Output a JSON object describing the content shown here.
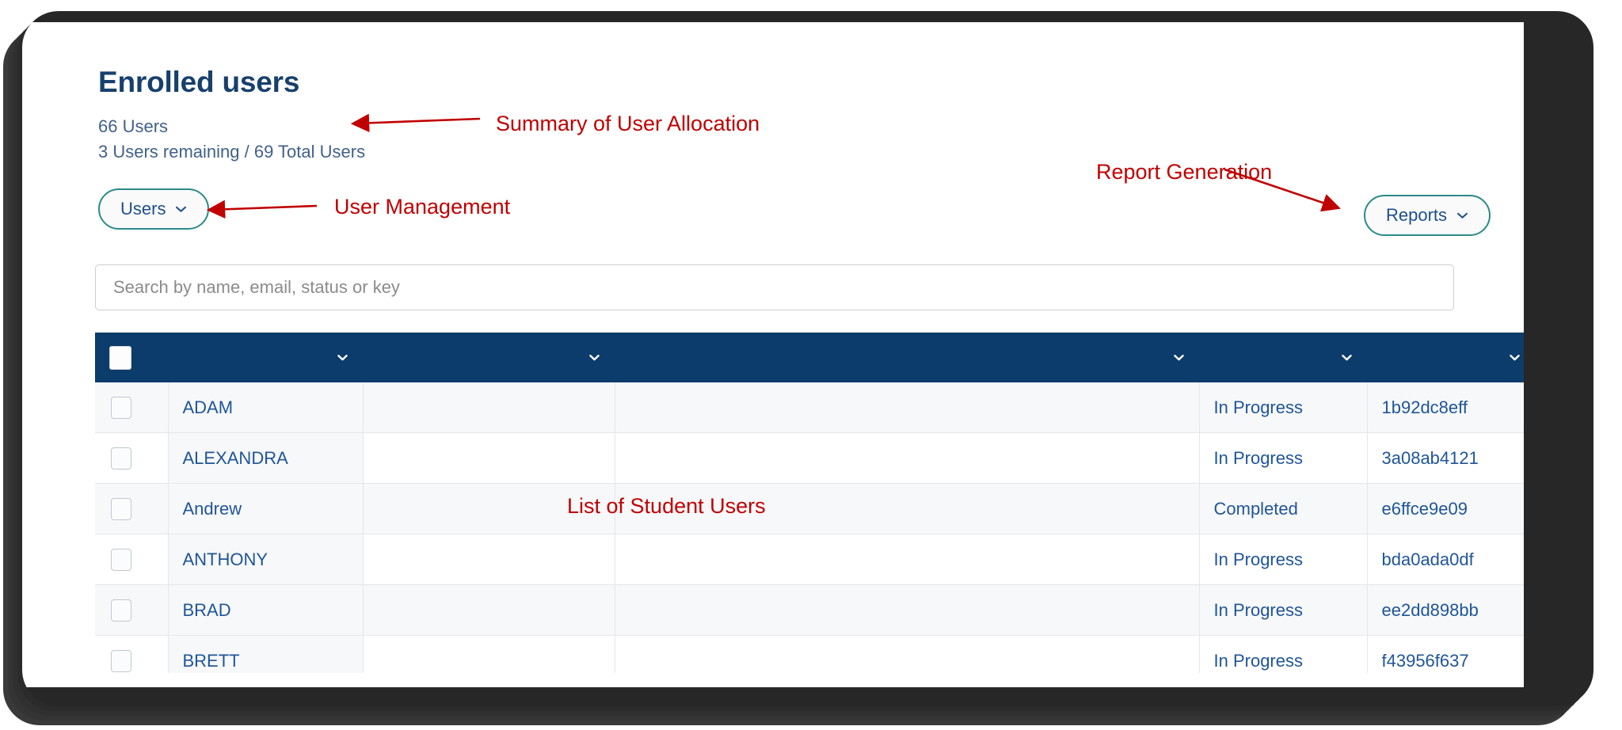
{
  "page": {
    "title": "Enrolled users",
    "summary_lines": [
      "66 Users",
      "3 Users remaining / 69 Total Users"
    ]
  },
  "toolbar": {
    "users_button": "Users",
    "reports_button": "Reports",
    "chevron_icon": "chevron-down-icon"
  },
  "search": {
    "placeholder": "Search by name, email, status or key",
    "value": ""
  },
  "table": {
    "columns": [
      {
        "key": "check",
        "label": "",
        "sortable": false
      },
      {
        "key": "name",
        "label": "",
        "sortable": true
      },
      {
        "key": "blank1",
        "label": "",
        "sortable": true
      },
      {
        "key": "blank2",
        "label": "",
        "sortable": true
      },
      {
        "key": "status",
        "label": "",
        "sortable": true
      },
      {
        "key": "key",
        "label": "",
        "sortable": true
      }
    ],
    "header_select_all": "select-all-checkbox",
    "rows": [
      {
        "name": "ADAM",
        "blank1": "",
        "blank2": "",
        "status": "In Progress",
        "key": "1b92dc8eff"
      },
      {
        "name": "ALEXANDRA",
        "blank1": "",
        "blank2": "",
        "status": "In Progress",
        "key": "3a08ab4121"
      },
      {
        "name": "Andrew",
        "blank1": "",
        "blank2": "",
        "status": "Completed",
        "key": "e6ffce9e09"
      },
      {
        "name": "ANTHONY",
        "blank1": "",
        "blank2": "",
        "status": "In Progress",
        "key": "bda0ada0df"
      },
      {
        "name": "BRAD",
        "blank1": "",
        "blank2": "",
        "status": "In Progress",
        "key": "ee2dd898bb"
      },
      {
        "name": "BRETT",
        "blank1": "",
        "blank2": "",
        "status": "In Progress",
        "key": "f43956f637"
      }
    ]
  },
  "annotations": {
    "summary": "Summary of User Allocation",
    "user_management": "User Management",
    "report_generation": "Report Generation",
    "student_list": "List of Student Users",
    "color": "#c00000"
  },
  "colors": {
    "title_navy": "#17406d",
    "table_header_navy": "#0c3c6b",
    "pill_border_teal": "#2b8a8a",
    "cell_text_blue": "#1f5599",
    "summary_text": "#41618a",
    "row_alt": "#f7f8f9"
  }
}
